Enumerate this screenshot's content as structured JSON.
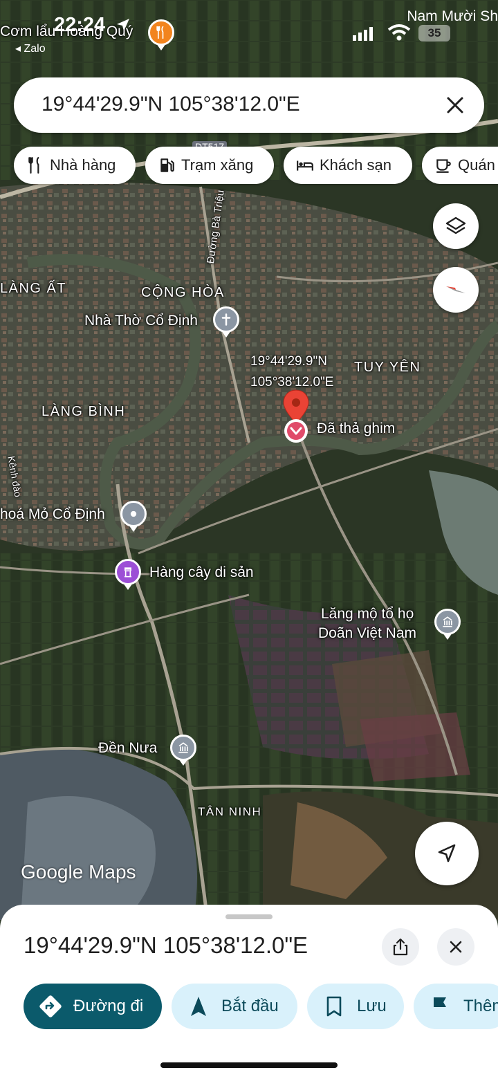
{
  "status_bar": {
    "time": "22:24",
    "back_app": "◂ Zalo",
    "carrier": "Nam Mười Sh",
    "battery": "35"
  },
  "search": {
    "query": "19°44'29.9\"N 105°38'12.0\"E"
  },
  "chips": [
    {
      "label": "Nhà hàng",
      "icon": "fork-knife-icon"
    },
    {
      "label": "Trạm xăng",
      "icon": "gas-station-icon"
    },
    {
      "label": "Khách sạn",
      "icon": "bed-icon"
    },
    {
      "label": "Quán",
      "icon": "coffee-cup-icon"
    }
  ],
  "map": {
    "top_poi": "Cơm lẩu Hoàng Quý",
    "road_badge": "DT517",
    "road_label": "Đường Bà Triệu",
    "canal_label": "Kênh đào",
    "areas": [
      "LÀNG ẤT",
      "CỘNG HÒA",
      "TUY YÊN",
      "LÀNG BÌNH",
      "TÂN NINH"
    ],
    "pois": {
      "church": "Nhà Thờ Cổ Định",
      "mine": "hoá Mỏ Cổ Định",
      "trees": "Hàng cây di sản",
      "tomb_line1": "Lăng mộ tổ họ",
      "tomb_line2": "Doãn Việt Nam",
      "temple": "Đền Nưa"
    },
    "pin_coord_line1": "19°44'29.9\"N",
    "pin_coord_line2": "105°38'12.0\"E",
    "pin_label": "Đã thả ghim",
    "watermark": "Google Maps"
  },
  "sheet": {
    "title": "19°44'29.9\"N 105°38'12.0\"E",
    "actions": [
      {
        "label": "Đường đi",
        "icon": "directions-icon"
      },
      {
        "label": "Bắt đầu",
        "icon": "navigation-arrow-icon"
      },
      {
        "label": "Lưu",
        "icon": "bookmark-icon"
      },
      {
        "label": "Thêm",
        "icon": "flag-icon"
      }
    ]
  },
  "colors": {
    "accent_teal": "#0b5a6b",
    "chip_light": "#d9f1fb",
    "pin_red": "#ea4335"
  }
}
